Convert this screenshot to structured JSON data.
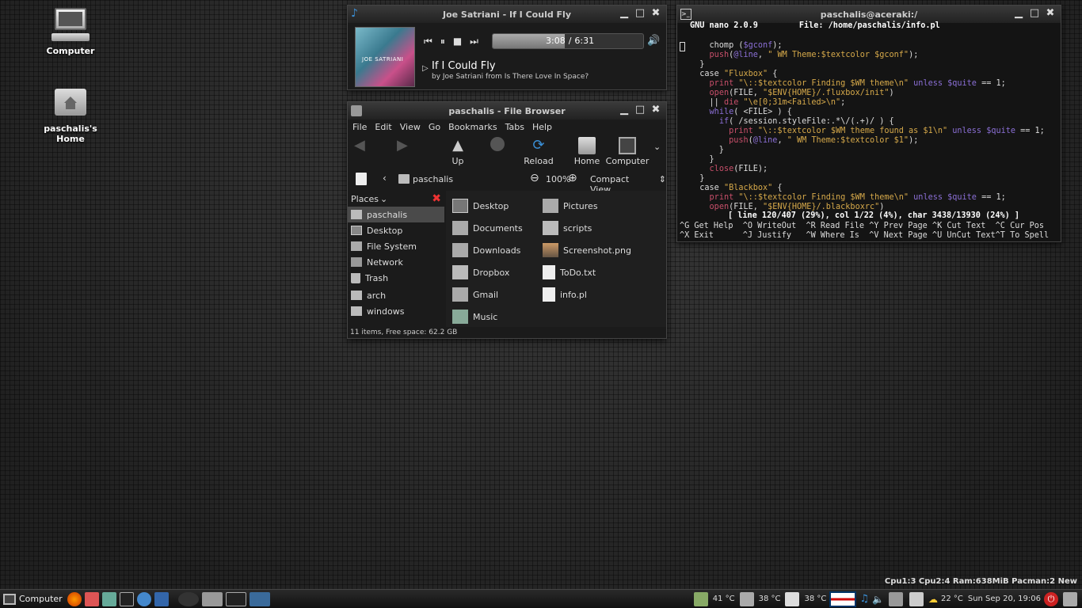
{
  "desktop": {
    "icons": [
      {
        "label": "Computer"
      },
      {
        "label": "paschalis's Home"
      }
    ]
  },
  "player": {
    "title": "Joe Satriani - If I Could Fly",
    "time_current": "3:08",
    "time_sep": "/",
    "time_total": "6:31",
    "progress": 0.48,
    "track": "If I Could Fly",
    "subtitle": "by Joe Satriani from Is There Love In Space?",
    "album_text": "JOE SATRIANI"
  },
  "fb": {
    "title": "paschalis - File Browser",
    "menu": [
      "File",
      "Edit",
      "View",
      "Go",
      "Bookmarks",
      "Tabs",
      "Help"
    ],
    "toolbar": {
      "up": "Up",
      "reload": "Reload",
      "home": "Home",
      "computer": "Computer"
    },
    "location": "paschalis",
    "zoom": "100%",
    "view_mode": "Compact View",
    "places_label": "Places",
    "places": [
      "paschalis",
      "Desktop",
      "File System",
      "Network",
      "Trash"
    ],
    "bookmarks": [
      "arch",
      "windows"
    ],
    "files_col1": [
      "Desktop",
      "Documents",
      "Downloads",
      "Dropbox",
      "Gmail",
      "Music"
    ],
    "files_col2": [
      "Pictures",
      "scripts",
      "Screenshot.png",
      "ToDo.txt",
      "info.pl"
    ],
    "status": "11 items, Free space: 62.2 GB"
  },
  "term": {
    "title": "paschalis@aceraki:/",
    "nano_version": "GNU nano 2.0.9",
    "file": "File: /home/paschalis/info.pl",
    "status": "[ line 120/407 (29%), col 1/22 (4%), char 3438/13930 (24%) ]",
    "help1": "^G Get Help  ^O WriteOut  ^R Read File ^Y Prev Page ^K Cut Text  ^C Cur Pos",
    "help2": "^X Exit      ^J Justify   ^W Where Is  ^V Next Page ^U UnCut Text^T To Spell"
  },
  "conky": "Cpu1:3 Cpu2:4 Ram:638MiB Pacman:2 New",
  "taskbar": {
    "start": "Computer",
    "temp1": "41 °C",
    "temp2": "38 °C",
    "temp3": "38 °C",
    "weather": "22 °C",
    "clock": "Sun Sep 20, 19:06"
  }
}
